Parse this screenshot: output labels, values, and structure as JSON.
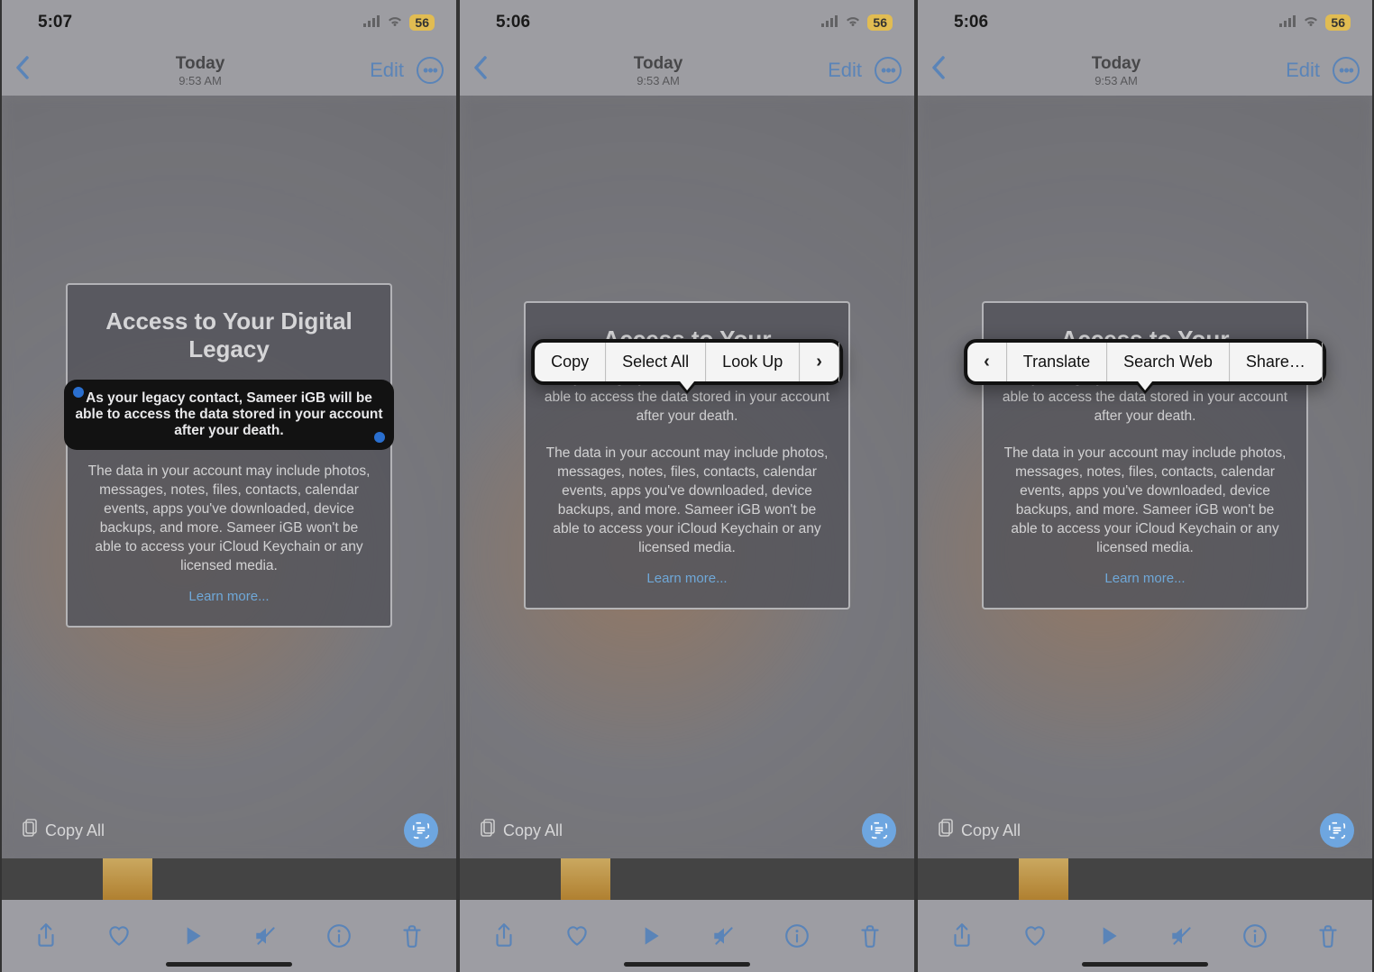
{
  "panels": [
    {
      "status_time": "5:07",
      "battery": "56",
      "nav": {
        "title": "Today",
        "subtitle": "9:53 AM",
        "edit": "Edit"
      },
      "modal": {
        "heading": "Access to Your Digital Legacy",
        "selected": "As your legacy contact, Sameer iGB will be able to access the data stored in your account after your death.",
        "para2": "The data in your account may include photos, messages, notes, files, contacts, calendar events, apps you've downloaded, device backups, and more. Sameer iGB won't be able to access your iCloud Keychain or any licensed media.",
        "learn": "Learn more..."
      },
      "copy_all": "Copy All"
    },
    {
      "status_time": "5:06",
      "battery": "56",
      "nav": {
        "title": "Today",
        "subtitle": "9:53 AM",
        "edit": "Edit"
      },
      "modal": {
        "heading": "Access to Your",
        "selected": "As your legacy contact, Sameer iGB will be able to access the data stored in your account after your death.",
        "para2": "The data in your account may include photos, messages, notes, files, contacts, calendar events, apps you've downloaded, device backups, and more. Sameer iGB won't be able to access your iCloud Keychain or any licensed media.",
        "learn": "Learn more..."
      },
      "copy_all": "Copy All",
      "ctx": [
        "Copy",
        "Select All",
        "Look Up"
      ]
    },
    {
      "status_time": "5:06",
      "battery": "56",
      "nav": {
        "title": "Today",
        "subtitle": "9:53 AM",
        "edit": "Edit"
      },
      "modal": {
        "heading": "Access to Your",
        "selected": "As your legacy contact, Sameer iGB will be able to access the data stored in your account after your death.",
        "para2": "The data in your account may include photos, messages, notes, files, contacts, calendar events, apps you've downloaded, device backups, and more. Sameer iGB won't be able to access your iCloud Keychain or any licensed media.",
        "learn": "Learn more..."
      },
      "copy_all": "Copy All",
      "ctx": [
        "Translate",
        "Search Web",
        "Share…"
      ]
    }
  ]
}
